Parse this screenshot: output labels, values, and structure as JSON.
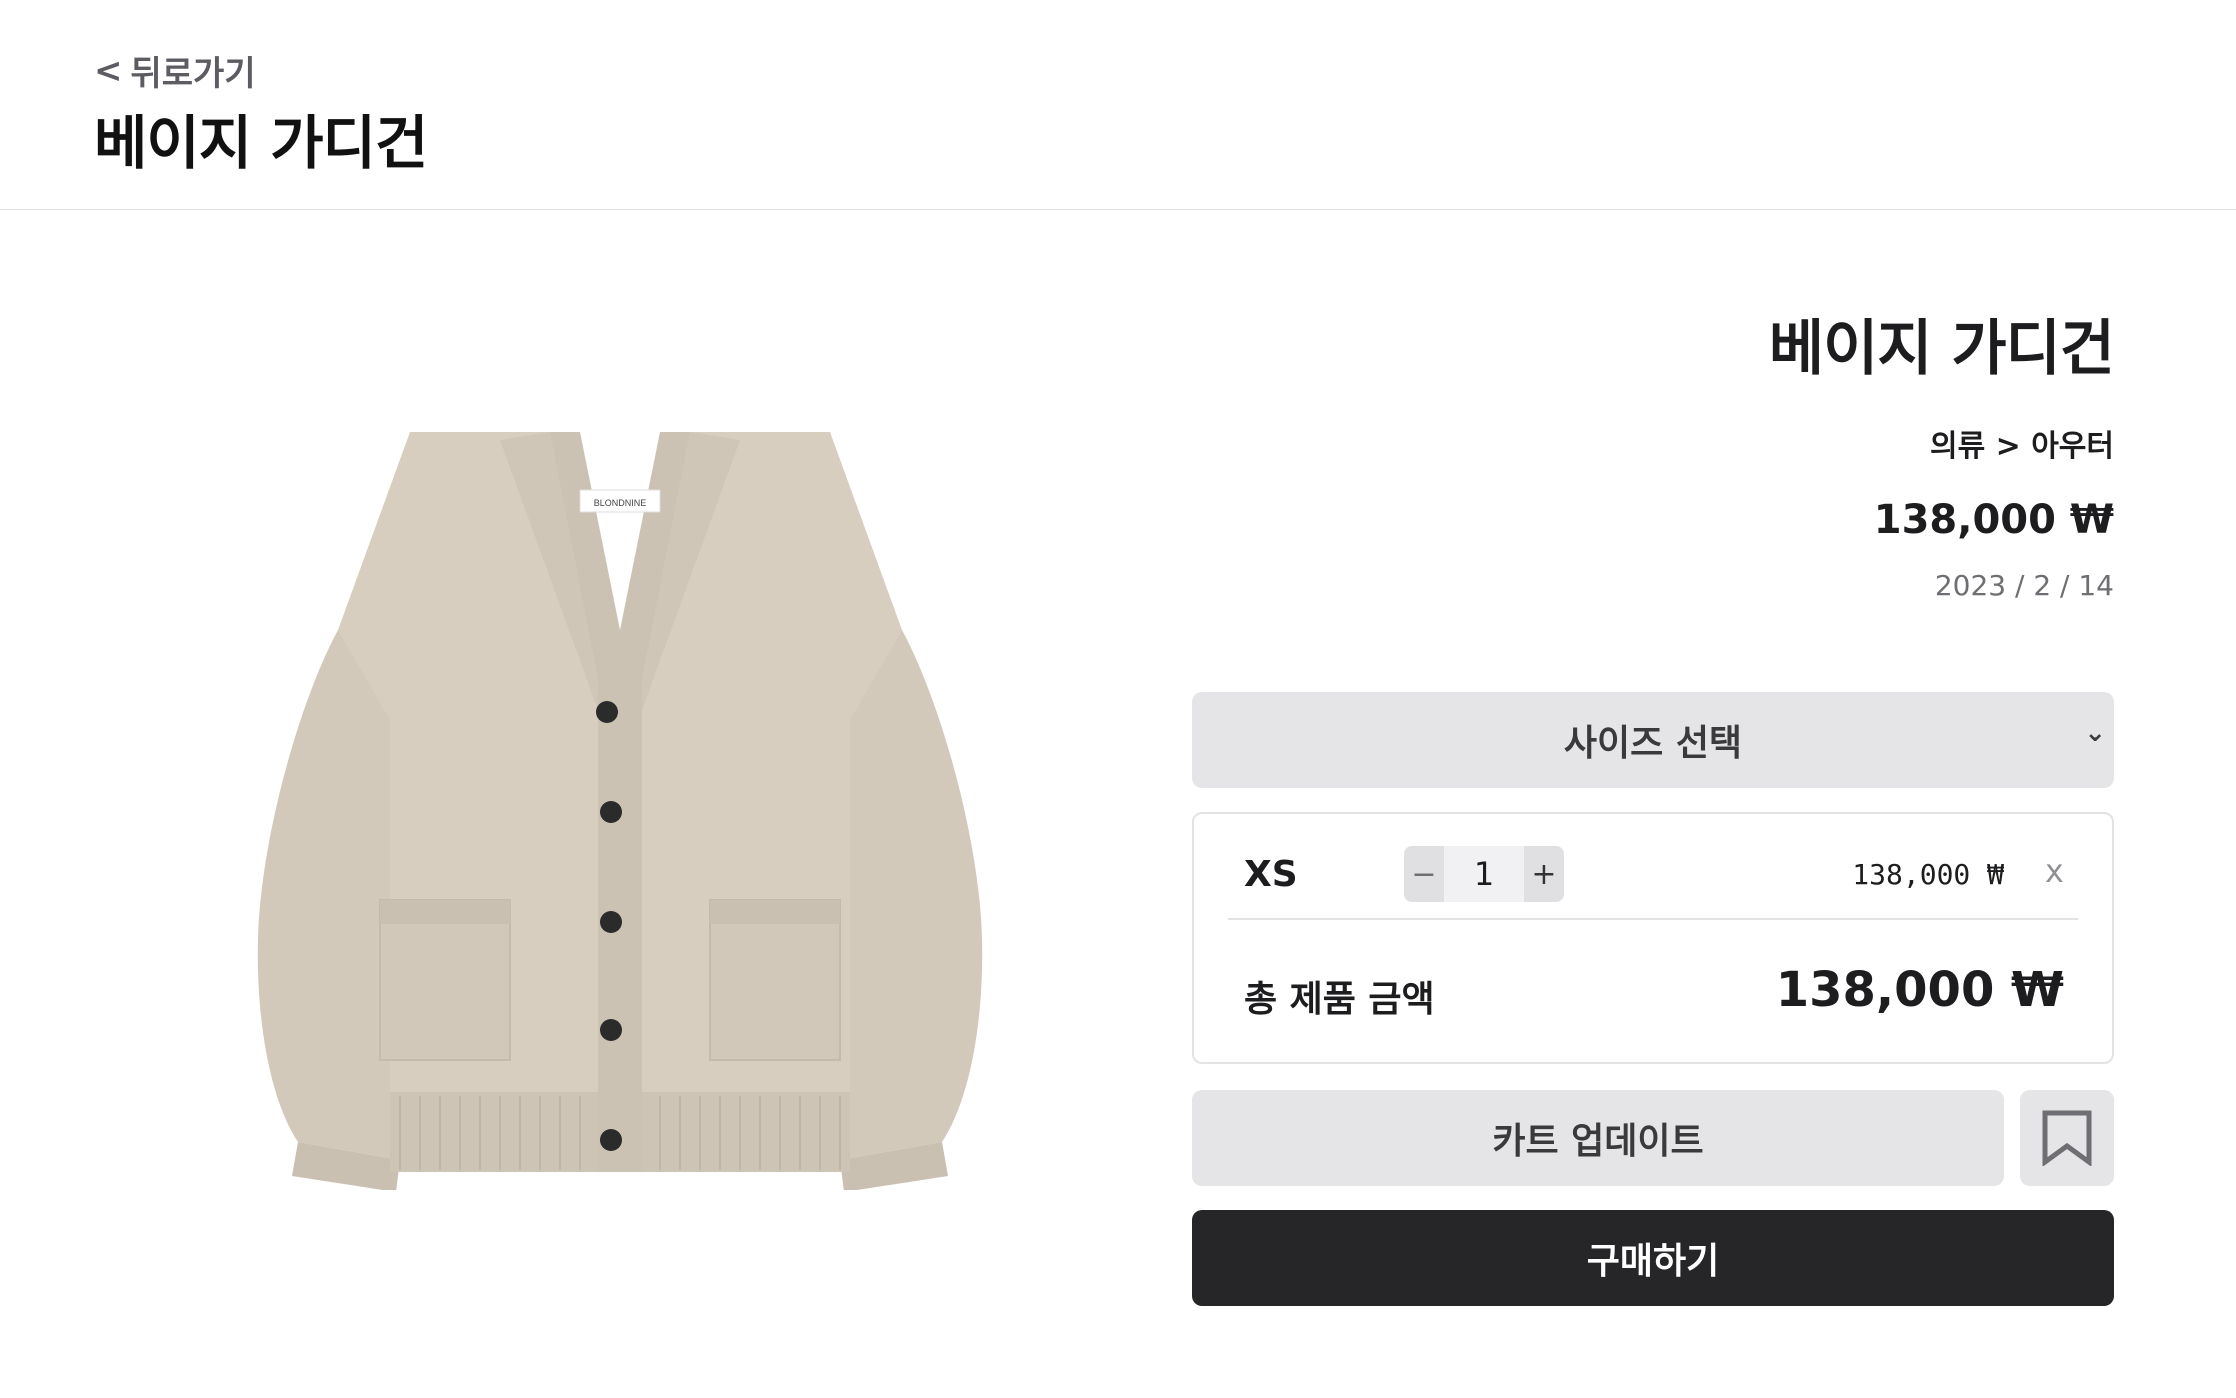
{
  "header": {
    "back_label": "뒤로가기",
    "back_icon": "chevron-left-icon",
    "title": "베이지 가디건"
  },
  "product": {
    "name": "베이지 가디건",
    "category": "의류 > 아우터",
    "price": "138,000 ₩",
    "date": "2023 / 2 / 14",
    "image_label": "BLONDNINE",
    "image_color": "#d4cbbd"
  },
  "size_select": {
    "label": "사이즈 선택",
    "icon": "chevron-down-icon"
  },
  "selected_option": {
    "size": "XS",
    "minus": "−",
    "quantity": "1",
    "plus": "+",
    "price": "138,000 ₩",
    "remove": "x"
  },
  "total": {
    "label": "총 제품 금액",
    "value": "138,000 ₩"
  },
  "actions": {
    "cart_update": "카트 업데이트",
    "bookmark_icon": "bookmark-icon",
    "buy": "구매하기"
  },
  "colors": {
    "button_gray": "#e5e5e8",
    "buy_button": "#262628",
    "border": "#e3e3e6"
  }
}
